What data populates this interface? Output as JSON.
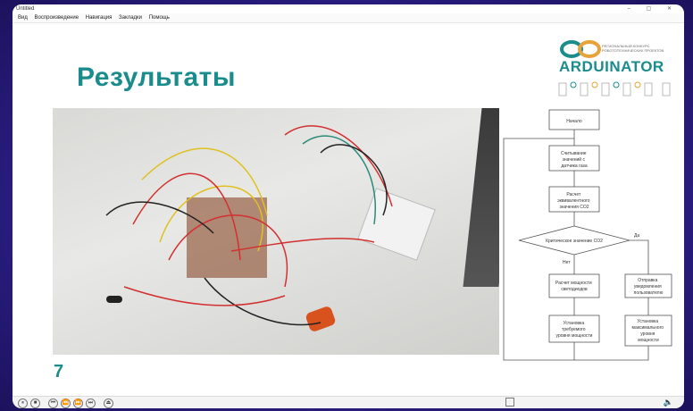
{
  "window": {
    "title": "Untitled",
    "controls": "–  ▢  ✕"
  },
  "menu": [
    "Вид",
    "Воспроизведение",
    "Навигация",
    "Закладки",
    "Помощь"
  ],
  "slide": {
    "title": "Результаты",
    "page_number": "7",
    "logo": {
      "brand": "ARDUINATOR",
      "subtitle": "РЕГИОНАЛЬНЫЙ КОНКУРС РОБОТОТЕХНИЧЕСКИХ ПРОЕКТОВ"
    }
  },
  "flowchart": {
    "start": "Начало",
    "read": [
      "Считывание",
      "значений с",
      "датчика газа"
    ],
    "calc": [
      "Расчет",
      "эквивалентного",
      "значения CO2"
    ],
    "decision": "Критическое значение CO2",
    "yes": "Да",
    "no": "Нет",
    "power_calc": [
      "Расчет мощности",
      "светодиодов"
    ],
    "notify": [
      "Отправка",
      "уведомления",
      "пользователю"
    ],
    "set_power": [
      "Установка",
      "требуемого",
      "уровня мощности"
    ],
    "set_level": [
      "Установка",
      "максимального",
      "уровня",
      "мощности"
    ]
  },
  "player": {
    "buttons": [
      "⏸",
      "■",
      "⏮",
      "⏪",
      "⏩",
      "⏭",
      "⏏"
    ],
    "volume_icon": "🔈"
  }
}
